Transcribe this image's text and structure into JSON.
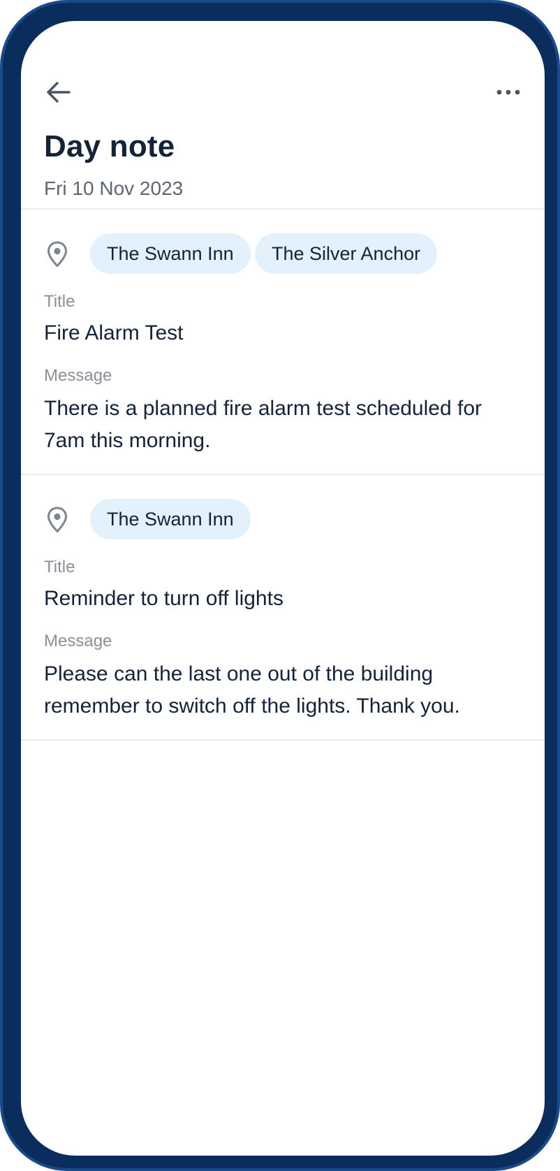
{
  "header": {
    "title": "Day note",
    "date": "Fri 10 Nov 2023",
    "back_icon": "arrow-left-icon",
    "more_icon": "more-horizontal-icon"
  },
  "notes": [
    {
      "locations": [
        "The Swann Inn",
        "The Silver Anchor"
      ],
      "title_label": "Title",
      "title": "Fire Alarm Test",
      "message_label": "Message",
      "message": "There is a planned fire alarm test scheduled for 7am this morning."
    },
    {
      "locations": [
        "The Swann Inn"
      ],
      "title_label": "Title",
      "title": "Reminder to turn off lights",
      "message_label": "Message",
      "message": "Please can the last one out of the building remember to switch off the lights. Thank you."
    }
  ],
  "colors": {
    "frame": "#0a2d5e",
    "chip_bg": "#e3f1fd",
    "text_primary": "#142338",
    "text_secondary": "#5d6673",
    "label": "#8a919b"
  }
}
